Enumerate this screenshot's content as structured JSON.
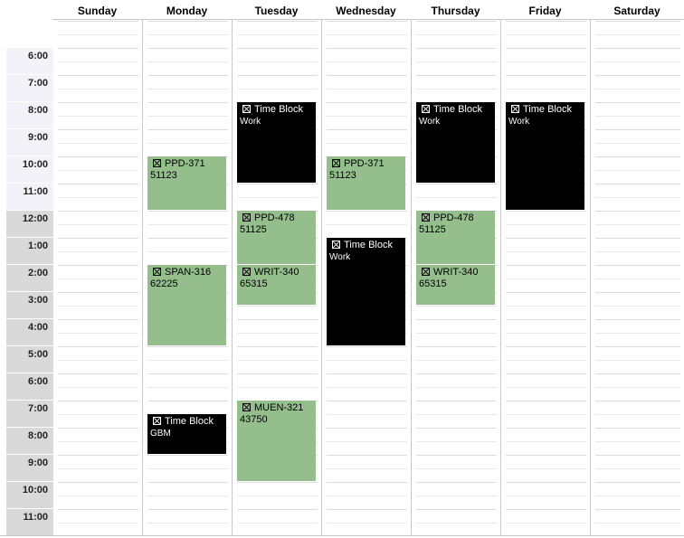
{
  "days": [
    "Sunday",
    "Monday",
    "Tuesday",
    "Wednesday",
    "Thursday",
    "Friday",
    "Saturday"
  ],
  "hours": [
    {
      "label": "",
      "period": "blank"
    },
    {
      "label": "6:00",
      "period": "am"
    },
    {
      "label": "7:00",
      "period": "am"
    },
    {
      "label": "8:00",
      "period": "am"
    },
    {
      "label": "9:00",
      "period": "am"
    },
    {
      "label": "10:00",
      "period": "am"
    },
    {
      "label": "11:00",
      "period": "am"
    },
    {
      "label": "12:00",
      "period": "pm"
    },
    {
      "label": "1:00",
      "period": "pm"
    },
    {
      "label": "2:00",
      "period": "pm"
    },
    {
      "label": "3:00",
      "period": "pm"
    },
    {
      "label": "4:00",
      "period": "pm"
    },
    {
      "label": "5:00",
      "period": "pm"
    },
    {
      "label": "6:00",
      "period": "pm"
    },
    {
      "label": "7:00",
      "period": "pm"
    },
    {
      "label": "8:00",
      "period": "pm"
    },
    {
      "label": "9:00",
      "period": "pm"
    },
    {
      "label": "10:00",
      "period": "pm"
    },
    {
      "label": "11:00",
      "period": "pm"
    }
  ],
  "colors": {
    "course": "#94bf8d",
    "time_block": "#000000"
  },
  "events": [
    {
      "day": 1,
      "start": "10:00",
      "end": "12:00",
      "kind": "course",
      "title": "PPD-371",
      "subtitle": "51123",
      "icon": "checkbox-x-icon"
    },
    {
      "day": 1,
      "start": "14:00",
      "end": "17:00",
      "kind": "course",
      "title": "SPAN-316",
      "subtitle": "62225",
      "icon": "checkbox-x-icon"
    },
    {
      "day": 1,
      "start": "19:30",
      "end": "21:00",
      "kind": "time_block",
      "title": "Time Block",
      "subtitle": "GBM",
      "icon": "checkbox-x-icon"
    },
    {
      "day": 2,
      "start": "08:00",
      "end": "11:00",
      "kind": "time_block",
      "title": "Time Block",
      "subtitle": "Work",
      "icon": "checkbox-x-icon"
    },
    {
      "day": 2,
      "start": "12:00",
      "end": "14:00",
      "kind": "course",
      "title": "PPD-478",
      "subtitle": "51125",
      "icon": "checkbox-x-icon"
    },
    {
      "day": 2,
      "start": "14:00",
      "end": "15:30",
      "kind": "course",
      "title": "WRIT-340",
      "subtitle": "65315",
      "icon": "checkbox-x-icon"
    },
    {
      "day": 2,
      "start": "19:00",
      "end": "22:00",
      "kind": "course",
      "title": "MUEN-321",
      "subtitle": "43750",
      "icon": "checkbox-x-icon"
    },
    {
      "day": 3,
      "start": "10:00",
      "end": "12:00",
      "kind": "course",
      "title": "PPD-371",
      "subtitle": "51123",
      "icon": "checkbox-x-icon"
    },
    {
      "day": 3,
      "start": "13:00",
      "end": "17:00",
      "kind": "time_block",
      "title": "Time Block",
      "subtitle": "Work",
      "icon": "checkbox-x-icon"
    },
    {
      "day": 4,
      "start": "08:00",
      "end": "11:00",
      "kind": "time_block",
      "title": "Time Block",
      "subtitle": "Work",
      "icon": "checkbox-x-icon"
    },
    {
      "day": 4,
      "start": "12:00",
      "end": "14:00",
      "kind": "course",
      "title": "PPD-478",
      "subtitle": "51125",
      "icon": "checkbox-x-icon"
    },
    {
      "day": 4,
      "start": "14:00",
      "end": "15:30",
      "kind": "course",
      "title": "WRIT-340",
      "subtitle": "65315",
      "icon": "checkbox-x-icon"
    },
    {
      "day": 5,
      "start": "08:00",
      "end": "12:00",
      "kind": "time_block",
      "title": "Time Block",
      "subtitle": "Work",
      "icon": "checkbox-x-icon"
    }
  ]
}
